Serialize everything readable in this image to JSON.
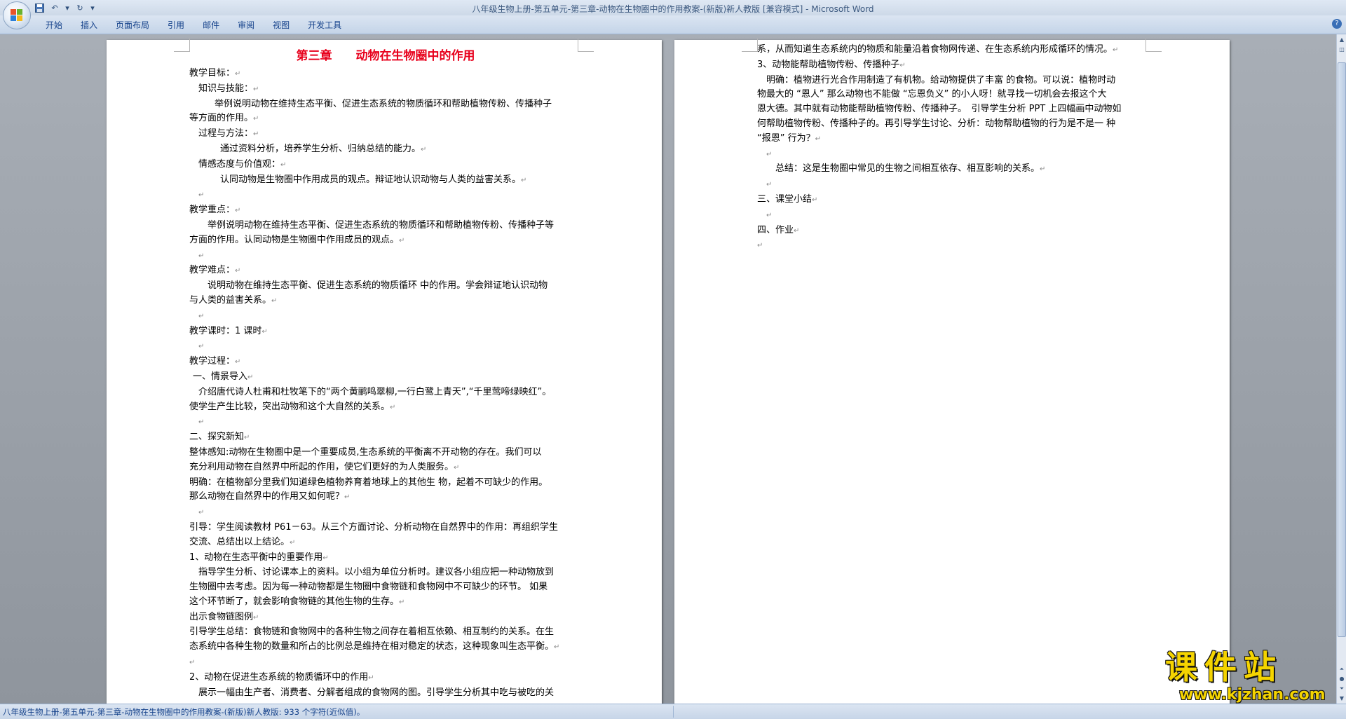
{
  "window": {
    "title": "八年级生物上册-第五单元-第三章-动物在生物圈中的作用教案-(新版)新人教版 [兼容模式] - Microsoft Word"
  },
  "ribbon": {
    "tabs": [
      "开始",
      "插入",
      "页面布局",
      "引用",
      "邮件",
      "审阅",
      "视图",
      "开发工具"
    ]
  },
  "page1": {
    "title": "第三章　　动物在生物圈中的作用",
    "lines": [
      "教学目标：",
      "知识与技能：",
      "举例说明动物在维持生态平衡、促进生态系统的物质循环和帮助植物传粉、传播种子",
      "等方面的作用。",
      "过程与方法：",
      "通过资料分析，培养学生分析、归纳总结的能力。",
      "情感态度与价值观：",
      "认同动物是生物圈中作用成员的观点。辩证地认识动物与人类的益害关系。",
      "",
      "教学重点：",
      "举例说明动物在维持生态平衡、促进生态系统的物质循环和帮助植物传粉、传播种子等",
      "方面的作用。认同动物是生物圈中作用成员的观点。",
      "",
      "教学难点：",
      "说明动物在维持生态平衡、促进生态系统的物质循环 中的作用。学会辩证地认识动物",
      "与人类的益害关系。",
      "",
      "教学课时：1 课时",
      "",
      "教学过程：",
      "一、情景导入",
      "介绍唐代诗人杜甫和杜牧笔下的“两个黄鹂鸣翠柳,一行白鹭上青天”,“千里莺啼绿映红”。",
      "使学生产生比较，突出动物和这个大自然的关系。",
      "",
      "二、探究新知",
      "整体感知:动物在生物圈中是一个重要成员,生态系统的平衡离不开动物的存在。我们可以",
      "充分利用动物在自然界中所起的作用，使它们更好的为人类服务。",
      "明确：在植物部分里我们知道绿色植物养育着地球上的其他生 物，起着不可缺少的作用。",
      "那么动物在自然界中的作用又如何呢？",
      "",
      "引导：学生阅读教材 P61－63。从三个方面讨论、分析动物在自然界中的作用：再组织学生",
      "交流、总结出以上结论。",
      "1、动物在生态平衡中的重要作用",
      "指导学生分析、讨论课本上的资料。以小组为单位分析时。建议各小组应把一种动物放到",
      "生物圈中去考虑。因为每一种动物都是生物圈中食物链和食物网中不可缺少的环节。 如果",
      "这个环节断了，就会影响食物链的其他生物的生存。",
      "出示食物链图例",
      "引导学生总结：食物链和食物网中的各种生物之间存在着相互依赖、相互制约的关系。在生",
      "态系统中各种生物的数量和所占的比例总是维持在相对稳定的状态，这种现象叫生态平衡。",
      "",
      "2、动物在促进生态系统的物质循环中的作用",
      "展示一幅由生产者、消费者、分解者组成的食物网的图。引导学生分析其中吃与被吃的关"
    ]
  },
  "page2": {
    "lines": [
      "系，从而知道生态系统内的物质和能量沿着食物网传递、在生态系统内形成循环的情况。",
      "3、动物能帮助植物传粉、传播种子",
      "明确：植物进行光合作用制造了有机物。给动物提供了丰富 的食物。可以说：植物时动",
      "物最大的 “恩人” 那么动物也不能做 “忘恩负义” 的小人呀！就寻找一切机会去报这个大",
      "恩大德。其中就有动物能帮助植物传粉、传播种子。　引导学生分析 PPT 上四幅画中动物如",
      "何帮助植物传粉、传播种子的。再引导学生讨论、分析：动物帮助植物的行为是不是一 种",
      "“报恩” 行为？",
      "",
      "总结：这是生物圈中常见的生物之间相互依存、相互影响的关系。",
      "",
      "三、课堂小结",
      "",
      "四、作业",
      ""
    ]
  },
  "status": {
    "text": "八年级生物上册-第五单元-第三章-动物在生物圈中的作用教案-(新版)新人教版: 933 个字符(近似值)。"
  },
  "watermark": {
    "main": "课件站",
    "url": "www.kjzhan.com"
  },
  "colors": {
    "title_red": "#e8001c",
    "ribbon_text": "#15428b",
    "watermark_yellow": "#f5d400"
  }
}
